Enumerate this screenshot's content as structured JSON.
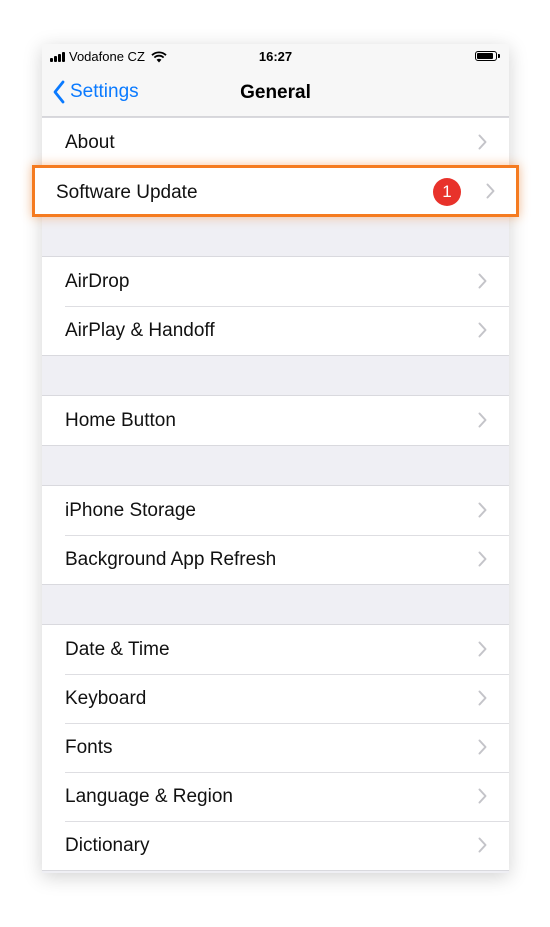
{
  "status_bar": {
    "carrier": "Vodafone CZ",
    "time": "16:27"
  },
  "nav": {
    "back_label": "Settings",
    "title": "General"
  },
  "sections": [
    {
      "items": [
        {
          "label": "About"
        }
      ]
    },
    {
      "items": [
        {
          "label": "AirDrop"
        },
        {
          "label": "AirPlay & Handoff"
        }
      ]
    },
    {
      "items": [
        {
          "label": "Home Button"
        }
      ]
    },
    {
      "items": [
        {
          "label": "iPhone Storage"
        },
        {
          "label": "Background App Refresh"
        }
      ]
    },
    {
      "items": [
        {
          "label": "Date & Time"
        },
        {
          "label": "Keyboard"
        },
        {
          "label": "Fonts"
        },
        {
          "label": "Language & Region"
        },
        {
          "label": "Dictionary"
        }
      ]
    }
  ],
  "software_update": {
    "label": "Software Update",
    "badge": "1"
  },
  "colors": {
    "accent": "#0a7aff",
    "badge": "#e8322b",
    "highlight": "#f57b20"
  }
}
